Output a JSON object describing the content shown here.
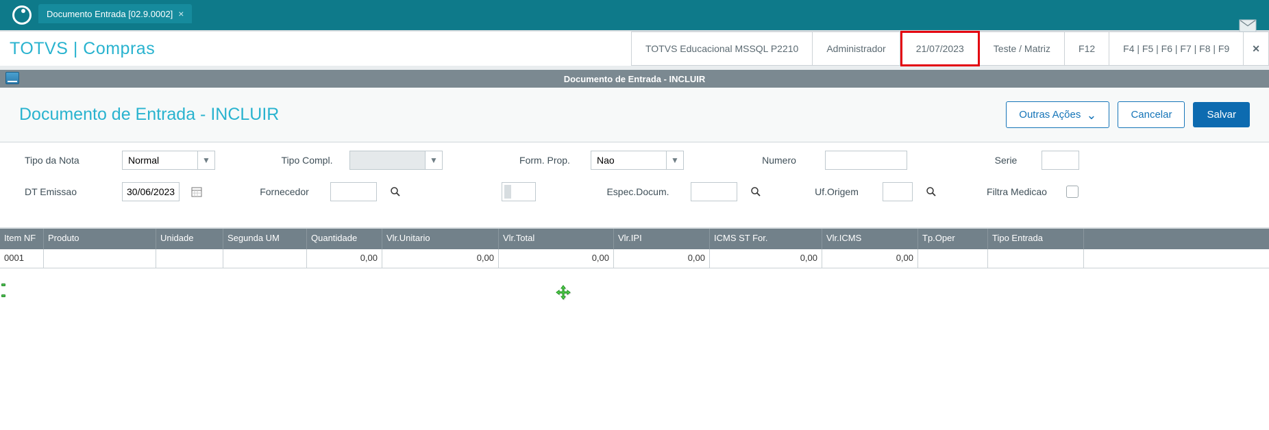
{
  "tab": {
    "title": "Documento Entrada [02.9.0002]"
  },
  "header": {
    "app_title": "TOTVS | Compras",
    "env": "TOTVS Educacional MSSQL P2210",
    "user": "Administrador",
    "date": "21/07/2023",
    "branch": "Teste / Matriz",
    "f12": "F12",
    "fkeys": "F4 | F5 | F6 | F7 | F8 | F9",
    "close": "✕"
  },
  "subtitle": "Documento de Entrada - INCLUIR",
  "page": {
    "title": "Documento de Entrada - INCLUIR",
    "other_actions": "Outras Ações",
    "cancel": "Cancelar",
    "save": "Salvar"
  },
  "form": {
    "labels": {
      "tipo_nota": "Tipo da Nota",
      "tipo_compl": "Tipo Compl.",
      "form_prop": "Form. Prop.",
      "numero": "Numero",
      "serie": "Serie",
      "dt_emissao": "DT Emissao",
      "fornecedor": "Fornecedor",
      "espec_docum": "Espec.Docum.",
      "uf_origem": "Uf.Origem",
      "filtra_medicao": "Filtra Medicao"
    },
    "values": {
      "tipo_nota": "Normal",
      "tipo_compl": "",
      "form_prop": "Nao",
      "numero": "",
      "serie": "",
      "dt_emissao": "30/06/2023",
      "fornecedor": "",
      "espec_docum": "",
      "uf_origem": ""
    }
  },
  "grid": {
    "headers": {
      "item": "Item NF",
      "produto": "Produto",
      "unidade": "Unidade",
      "segunda_um": "Segunda UM",
      "quantidade": "Quantidade",
      "vlr_unitario": "Vlr.Unitario",
      "vlr_total": "Vlr.Total",
      "vlr_ipi": "Vlr.IPI",
      "icms_st_for": "ICMS ST For.",
      "vlr_icms": "Vlr.ICMS",
      "tp_oper": "Tp.Oper",
      "tipo_entrada": "Tipo Entrada"
    },
    "rows": [
      {
        "item": "0001",
        "produto": "",
        "unidade": "",
        "segunda_um": "",
        "quantidade": "0,00",
        "vlr_unitario": "0,00",
        "vlr_total": "0,00",
        "vlr_ipi": "0,00",
        "icms_st_for": "0,00",
        "vlr_icms": "0,00",
        "tp_oper": "",
        "tipo_entrada": ""
      }
    ]
  }
}
